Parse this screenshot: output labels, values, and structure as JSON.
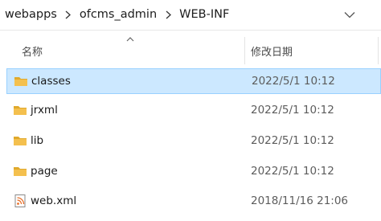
{
  "breadcrumb": {
    "items": [
      "webapps",
      "ofcms_admin",
      "WEB-INF"
    ]
  },
  "columns": {
    "name": "名称",
    "date_modified": "修改日期"
  },
  "files": [
    {
      "name": "classes",
      "date": "2022/5/1 10:12",
      "type": "folder",
      "selected": true
    },
    {
      "name": "jrxml",
      "date": "2022/5/1 10:12",
      "type": "folder",
      "selected": false
    },
    {
      "name": "lib",
      "date": "2022/5/1 10:12",
      "type": "folder",
      "selected": false
    },
    {
      "name": "page",
      "date": "2022/5/1 10:12",
      "type": "folder",
      "selected": false
    },
    {
      "name": "web.xml",
      "date": "2018/11/16 21:06",
      "type": "xml-file",
      "selected": false
    }
  ],
  "colors": {
    "folder": "#f4c04e",
    "folder_dark": "#e0a92c",
    "selection_bg": "#cce8ff",
    "selection_border": "#99d1ff"
  }
}
